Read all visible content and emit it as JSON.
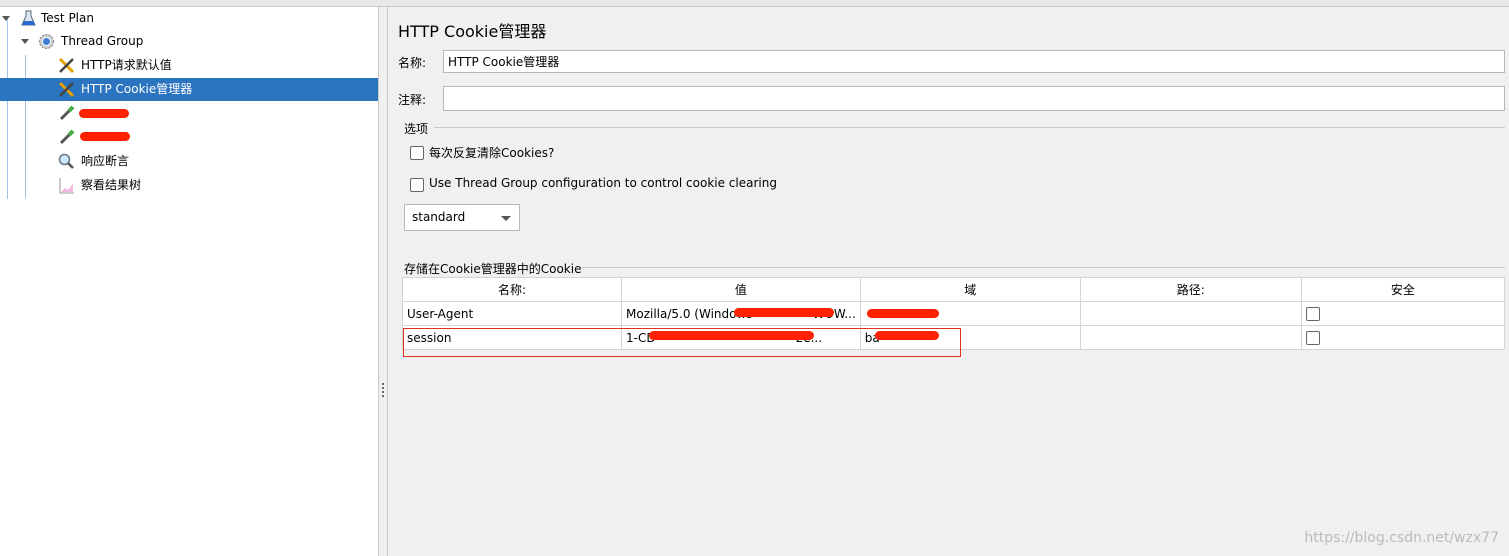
{
  "tree": {
    "items": [
      {
        "label": "Test Plan",
        "icon": "flask-icon"
      },
      {
        "label": "Thread Group",
        "icon": "gear-icon"
      },
      {
        "label": "HTTP请求默认值",
        "icon": "wrench-icon"
      },
      {
        "label": "HTTP Cookie管理器",
        "icon": "wrench-icon",
        "selected": true
      },
      {
        "label": "",
        "icon": "dropper-icon"
      },
      {
        "label": "",
        "icon": "dropper-icon"
      },
      {
        "label": "响应断言",
        "icon": "magnifier-icon"
      },
      {
        "label": "察看结果树",
        "icon": "chart-icon"
      }
    ]
  },
  "panel": {
    "title": "HTTP Cookie管理器",
    "name_label": "名称:",
    "name_value": "HTTP Cookie管理器",
    "comment_label": "注释:",
    "comment_value": "",
    "options_label": "选项",
    "clear_each_iteration": "每次反复清除Cookies?",
    "use_thread_group": "Use Thread Group configuration to control cookie clearing",
    "policy": "standard",
    "stored_label": "存储在Cookie管理器中的Cookie",
    "columns": [
      "名称:",
      "值",
      "域",
      "路径:",
      "安全"
    ],
    "rows": [
      {
        "name": "User-Agent",
        "value": "Mozilla/5.0 (Windows",
        "value_tail": "WOW...",
        "domain": "",
        "path": "",
        "secure": false
      },
      {
        "name": "session",
        "value": "1-CD",
        "value_tail": "2e...",
        "domain": "ba",
        "path": "",
        "secure": false
      }
    ]
  },
  "watermark": "https://blog.csdn.net/wzx77",
  "colors": {
    "selection": "#2a74c0",
    "highlight_border": "#e03020",
    "redaction": "#ff2200"
  }
}
